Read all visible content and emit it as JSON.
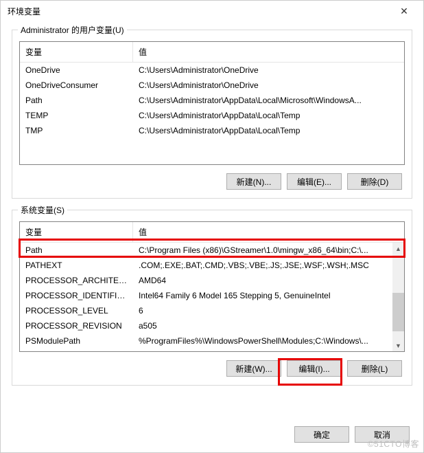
{
  "dialog": {
    "title": "环境变量"
  },
  "user_section": {
    "legend": "Administrator 的用户变量(U)",
    "headers": {
      "variable": "变量",
      "value": "值"
    },
    "rows": [
      {
        "variable": "OneDrive",
        "value": "C:\\Users\\Administrator\\OneDrive"
      },
      {
        "variable": "OneDriveConsumer",
        "value": "C:\\Users\\Administrator\\OneDrive"
      },
      {
        "variable": "Path",
        "value": "C:\\Users\\Administrator\\AppData\\Local\\Microsoft\\WindowsA..."
      },
      {
        "variable": "TEMP",
        "value": "C:\\Users\\Administrator\\AppData\\Local\\Temp"
      },
      {
        "variable": "TMP",
        "value": "C:\\Users\\Administrator\\AppData\\Local\\Temp"
      }
    ],
    "buttons": {
      "new": "新建(N)...",
      "edit": "编辑(E)...",
      "delete": "删除(D)"
    }
  },
  "system_section": {
    "legend": "系统变量(S)",
    "headers": {
      "variable": "变量",
      "value": "值"
    },
    "rows": [
      {
        "variable": "Path",
        "value": "C:\\Program Files (x86)\\GStreamer\\1.0\\mingw_x86_64\\bin;C:\\..."
      },
      {
        "variable": "PATHEXT",
        "value": ".COM;.EXE;.BAT;.CMD;.VBS;.VBE;.JS;.JSE;.WSF;.WSH;.MSC"
      },
      {
        "variable": "PROCESSOR_ARCHITECT...",
        "value": "AMD64"
      },
      {
        "variable": "PROCESSOR_IDENTIFIER",
        "value": "Intel64 Family 6 Model 165 Stepping 5, GenuineIntel"
      },
      {
        "variable": "PROCESSOR_LEVEL",
        "value": "6"
      },
      {
        "variable": "PROCESSOR_REVISION",
        "value": "a505"
      },
      {
        "variable": "PSModulePath",
        "value": "%ProgramFiles%\\WindowsPowerShell\\Modules;C:\\Windows\\..."
      }
    ],
    "buttons": {
      "new": "新建(W)...",
      "edit": "编辑(I)...",
      "delete": "删除(L)"
    }
  },
  "footer": {
    "ok": "确定",
    "cancel": "取消"
  },
  "watermark": "©51CTO博客"
}
